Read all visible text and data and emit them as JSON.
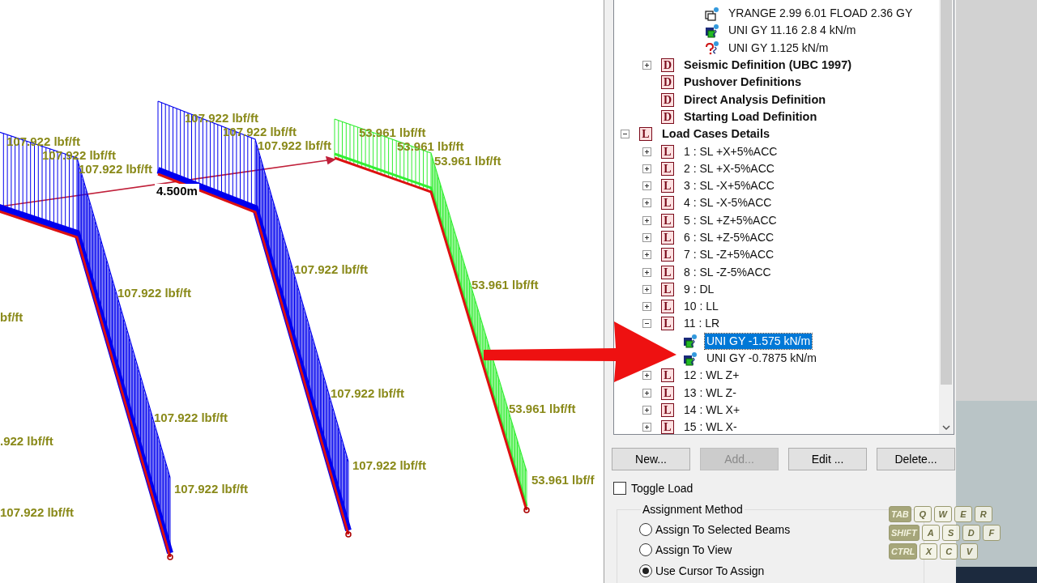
{
  "canvas": {
    "edge_labels": [
      "bf/ft",
      ".922 lbf/ft",
      "107.922 lbf/ft"
    ],
    "frames": [
      {
        "selected": false,
        "labels": [
          "107.922 lbf/ft",
          "107.922 lbf/ft",
          "107.922 lbf/ft",
          "107.922 lbf/ft",
          "107.922 lbf/ft",
          "107.922 lbf/ft"
        ]
      },
      {
        "selected": false,
        "labels": [
          "107.922 lbf/ft",
          "107.922 lbf/ft",
          "107.922 lbf/ft",
          "107.922 lbf/ft",
          "107.922 lbf/ft",
          "107.922 lbf/ft"
        ]
      },
      {
        "selected": true,
        "labels": [
          "53.961 lbf/ft",
          "53.961 lbf/ft",
          "53.961 lbf/ft",
          "53.961 lbf/ft",
          "53.961 lbf/ft",
          "53.961 lbf/f"
        ]
      }
    ],
    "dimension": "4.500m"
  },
  "tree": {
    "fragment": [
      {
        "kind": "range",
        "label": "YRANGE 2.99 6.01 FLOAD 2.36 GY",
        "selected": false
      },
      {
        "kind": "load",
        "label": "UNI GY 11.16 2.8 4 kN/m",
        "selected": false
      },
      {
        "kind": "unknown",
        "label": "UNI GY 1.125 kN/m",
        "selected": false
      }
    ],
    "definitions": [
      {
        "badge": "D",
        "label": "Seismic Definition (UBC 1997)",
        "expanded": false,
        "selected": false
      },
      {
        "badge": "D",
        "label": "Pushover Definitions",
        "selected": false
      },
      {
        "badge": "D",
        "label": "Direct Analysis Definition",
        "selected": false
      },
      {
        "badge": "D",
        "label": "Starting Load Definition",
        "selected": false
      }
    ],
    "load_cases": {
      "badge": "L",
      "label": "Load Cases Details",
      "expanded": true,
      "selected": false,
      "children": [
        {
          "badge": "L",
          "label": "1 : SL +X+5%ACC",
          "expanded": false,
          "selected": false
        },
        {
          "badge": "L",
          "label": "2 : SL +X-5%ACC",
          "expanded": false,
          "selected": false
        },
        {
          "badge": "L",
          "label": "3 : SL -X+5%ACC",
          "expanded": false,
          "selected": false
        },
        {
          "badge": "L",
          "label": "4 : SL -X-5%ACC",
          "expanded": false,
          "selected": false
        },
        {
          "badge": "L",
          "label": "5 : SL +Z+5%ACC",
          "expanded": false,
          "selected": false
        },
        {
          "badge": "L",
          "label": "6 : SL +Z-5%ACC",
          "expanded": false,
          "selected": false
        },
        {
          "badge": "L",
          "label": "7 : SL -Z+5%ACC",
          "expanded": false,
          "selected": false
        },
        {
          "badge": "L",
          "label": "8 : SL -Z-5%ACC",
          "expanded": false,
          "selected": false
        },
        {
          "badge": "L",
          "label": "9 : DL",
          "expanded": false,
          "selected": false
        },
        {
          "badge": "L",
          "label": "10 : LL",
          "expanded": false,
          "selected": false
        },
        {
          "badge": "L",
          "label": "11 : LR",
          "expanded": true,
          "selected": false,
          "children": [
            {
              "kind": "load",
              "label": "UNI GY -1.575 kN/m",
              "selected": true
            },
            {
              "kind": "load",
              "label": "UNI GY -0.7875 kN/m",
              "selected": false
            }
          ]
        },
        {
          "badge": "L",
          "label": "12 : WL Z+",
          "expanded": false,
          "selected": false
        },
        {
          "badge": "L",
          "label": "13 : WL Z-",
          "expanded": false,
          "selected": false
        },
        {
          "badge": "L",
          "label": "14 : WL X+",
          "expanded": false,
          "selected": false
        },
        {
          "badge": "L",
          "label": "15 : WL X-",
          "expanded": false,
          "selected": false
        }
      ]
    }
  },
  "buttons": [
    {
      "label": "New...",
      "disabled": false
    },
    {
      "label": "Add...",
      "disabled": true
    },
    {
      "label": "Edit ...",
      "disabled": false
    },
    {
      "label": "Delete...",
      "disabled": false
    }
  ],
  "toggle_load": {
    "label": "Toggle Load",
    "checked": false
  },
  "assignment_method": {
    "title": "Assignment Method",
    "options": [
      {
        "label": "Assign To Selected Beams",
        "selected": false
      },
      {
        "label": "Assign To View",
        "selected": false
      },
      {
        "label": "Use Cursor To Assign",
        "selected": true
      }
    ]
  },
  "key_overlay": {
    "rows": [
      [
        "TAB",
        "Q",
        "W",
        "E",
        "R"
      ],
      [
        "SHIFT",
        "A",
        "S",
        "D",
        "F"
      ],
      [
        "CTRL",
        "X",
        "C",
        "V"
      ]
    ]
  }
}
